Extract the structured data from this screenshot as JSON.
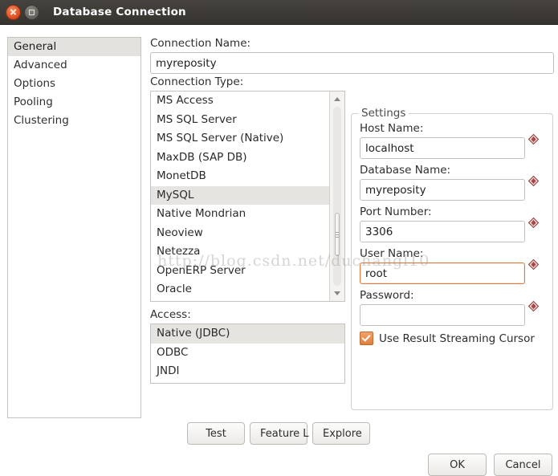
{
  "window": {
    "title": "Database Connection",
    "close_icon": "close-icon",
    "maximize_icon": "maximize-icon"
  },
  "sidebar": {
    "items": [
      {
        "label": "General",
        "selected": true
      },
      {
        "label": "Advanced",
        "selected": false
      },
      {
        "label": "Options",
        "selected": false
      },
      {
        "label": "Pooling",
        "selected": false
      },
      {
        "label": "Clustering",
        "selected": false
      }
    ]
  },
  "connection_name": {
    "label": "Connection Name:",
    "value": "myreposity",
    "placeholder": ""
  },
  "connection_type": {
    "label": "Connection Type:",
    "options": [
      {
        "label": "MS Access",
        "selected": false
      },
      {
        "label": "MS SQL Server",
        "selected": false
      },
      {
        "label": "MS SQL Server (Native)",
        "selected": false
      },
      {
        "label": "MaxDB (SAP DB)",
        "selected": false
      },
      {
        "label": "MonetDB",
        "selected": false
      },
      {
        "label": "MySQL",
        "selected": true
      },
      {
        "label": "Native Mondrian",
        "selected": false
      },
      {
        "label": "Neoview",
        "selected": false
      },
      {
        "label": "Netezza",
        "selected": false
      },
      {
        "label": "OpenERP Server",
        "selected": false
      },
      {
        "label": "Oracle",
        "selected": false
      }
    ],
    "scrollbar": {
      "up_icon": "scroll-up-arrow-icon",
      "down_icon": "scroll-down-arrow-icon"
    }
  },
  "access": {
    "label": "Access:",
    "options": [
      {
        "label": "Native (JDBC)",
        "selected": true
      },
      {
        "label": "ODBC",
        "selected": false
      },
      {
        "label": "JNDI",
        "selected": false
      }
    ]
  },
  "settings": {
    "legend": "Settings",
    "fields": [
      {
        "label": "Host Name:",
        "value": "localhost",
        "focused": false,
        "badge": "variable-diamond-icon"
      },
      {
        "label": "Database Name:",
        "value": "myreposity",
        "focused": false,
        "badge": "variable-diamond-icon"
      },
      {
        "label": "Port Number:",
        "value": "3306",
        "focused": false,
        "badge": "variable-diamond-icon"
      },
      {
        "label": "User Name:",
        "value": "root",
        "focused": true,
        "badge": "variable-diamond-icon"
      },
      {
        "label": "Password:",
        "value": "",
        "focused": false,
        "badge": "variable-diamond-icon"
      }
    ],
    "streaming_cursor": {
      "label": "Use Result Streaming Cursor",
      "checked": true
    }
  },
  "action_buttons": {
    "test": "Test",
    "feature_list": "Feature L",
    "explore": "Explore"
  },
  "dialog_buttons": {
    "ok": "OK",
    "cancel": "Cancel"
  },
  "watermark": {
    "text": "http://blog.csdn.net/duchangl10"
  },
  "colors": {
    "titlebar": "#3c3935",
    "close_button": "#d8481b",
    "accent_focus": "#dd7b45",
    "checkbox_fill": "#e07f3c",
    "selection": "#e6e4e0",
    "badge": "#a94442"
  }
}
